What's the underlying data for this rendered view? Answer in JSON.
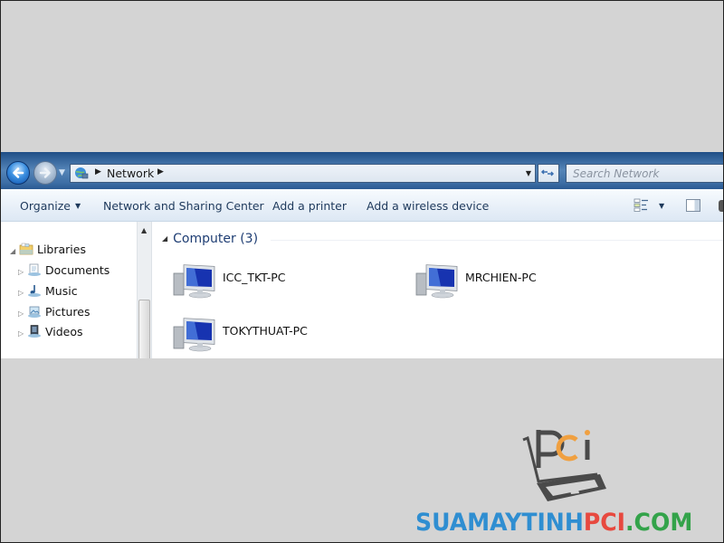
{
  "window": {
    "address": {
      "location": "Network",
      "globe_icon": "network-icon",
      "dropdown_icon": "chevron-down-icon",
      "refresh_icon": "refresh-icon"
    },
    "search": {
      "placeholder": "Search Network"
    },
    "toolbar": {
      "organize_label": "Organize",
      "network_sharing_label": "Network and Sharing Center",
      "add_printer_label": "Add a printer",
      "add_wireless_label": "Add a wireless device"
    },
    "nav_pane": {
      "libraries": {
        "label": "Libraries",
        "children": [
          {
            "label": "Documents",
            "icon": "documents-icon"
          },
          {
            "label": "Music",
            "icon": "music-icon"
          },
          {
            "label": "Pictures",
            "icon": "pictures-icon"
          },
          {
            "label": "Videos",
            "icon": "videos-icon"
          }
        ]
      }
    },
    "content": {
      "group_label": "Computer (3)",
      "computers": [
        {
          "name": "ICC_TKT-PC"
        },
        {
          "name": "MRCHIEN-PC"
        },
        {
          "name": "TOKYTHUAT-PC"
        }
      ]
    }
  },
  "watermark": {
    "logo_text": "pci",
    "brand_part1": "SUAMAYTINH",
    "brand_part2": "PCI",
    "brand_part3": ".COM",
    "colors": {
      "blue": "#2f8ed1",
      "red": "#e7493f",
      "green": "#33a34a",
      "orange": "#f0a040"
    }
  }
}
